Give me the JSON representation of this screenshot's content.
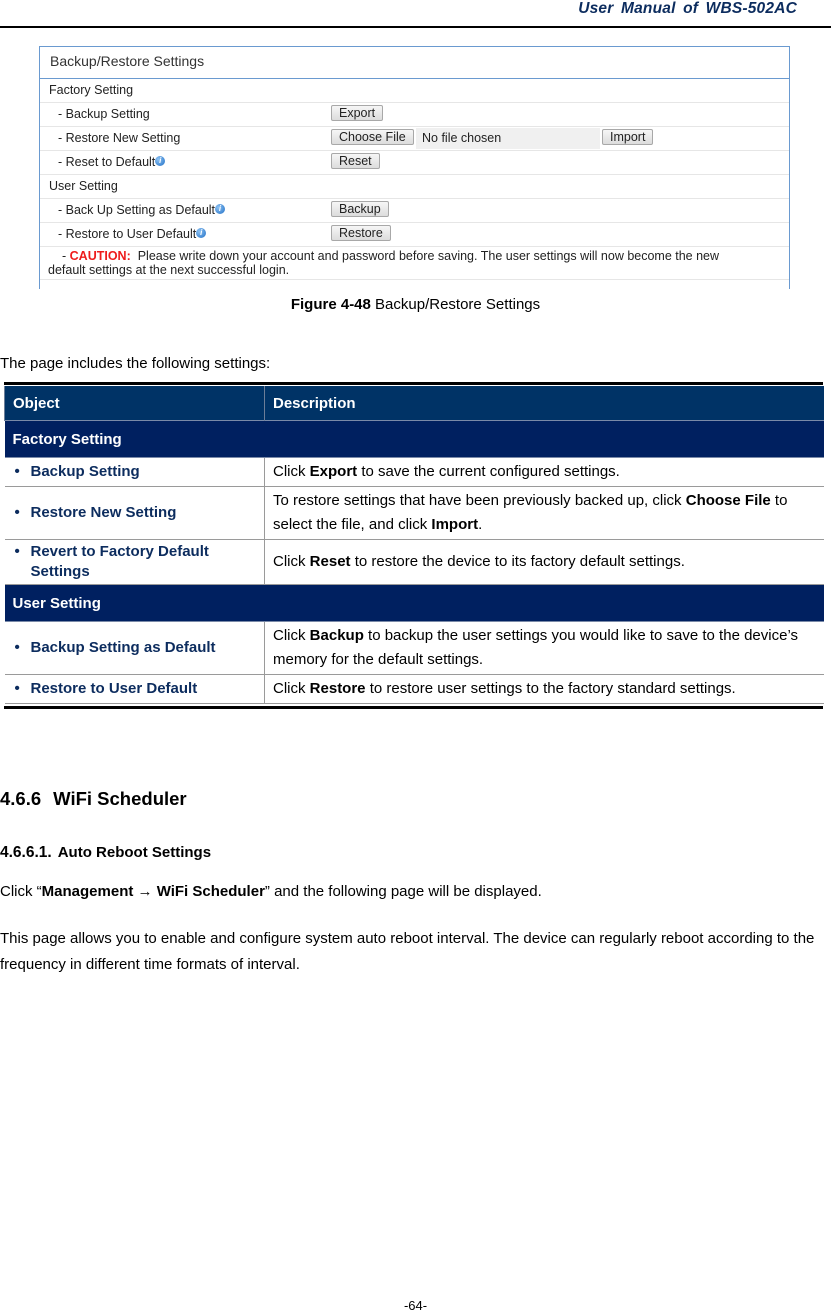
{
  "header": {
    "title": "User  Manual  of  WBS-502AC"
  },
  "figure": {
    "title": "Backup/Restore Settings",
    "sections": [
      {
        "label": "Factory Setting",
        "rows": [
          {
            "label": "- Backup Setting",
            "button": "Export"
          },
          {
            "label": "- Restore New Setting",
            "button": "Choose File",
            "file_status": "No file chosen",
            "button2": "Import"
          },
          {
            "label": "- Reset to Default",
            "button": "Reset",
            "info_icon": true
          }
        ]
      },
      {
        "label": "User Setting",
        "rows": [
          {
            "label": "- Back Up Setting as Default",
            "button": "Backup",
            "info_icon": true
          },
          {
            "label": "- Restore to User Default",
            "button": "Restore",
            "info_icon": true
          }
        ]
      }
    ],
    "caution": {
      "prefix": "- ",
      "word": "CAUTION:",
      "line1": "Please write down your account and password before saving. The user settings will now become the new",
      "line2": "default settings at the next successful login."
    },
    "caption_bold": "Figure 4-48",
    "caption_text": " Backup/Restore Settings"
  },
  "intro": "The page includes the following settings:",
  "table": {
    "headers": [
      "Object",
      "Description"
    ],
    "sections": [
      {
        "title": "Factory Setting",
        "rows": [
          {
            "object": "Backup Setting",
            "desc": [
              [
                "Click "
              ],
              [
                "Export",
                true
              ],
              [
                " to save the current configured settings."
              ]
            ]
          },
          {
            "object": "Restore New Setting",
            "desc": [
              [
                "To restore settings that have been previously backed up, click "
              ],
              [
                "Choose File",
                true
              ],
              [
                " to select the file, and click "
              ],
              [
                "Import",
                true
              ],
              [
                "."
              ]
            ]
          },
          {
            "object": "Revert to Factory Default",
            "object_line2": "Settings",
            "desc": [
              [
                "Click "
              ],
              [
                "Reset",
                true
              ],
              [
                " to restore the device to its factory default settings."
              ]
            ]
          }
        ]
      },
      {
        "title": "User Setting",
        "rows": [
          {
            "object": "Backup Setting as Default",
            "desc": [
              [
                "Click "
              ],
              [
                "Backup",
                true
              ],
              [
                " to backup the user settings you would like to save to the device’s memory for the default settings."
              ]
            ]
          },
          {
            "object": "Restore to User Default",
            "desc": [
              [
                "Click "
              ],
              [
                "Restore",
                true
              ],
              [
                " to restore user settings to the factory standard settings."
              ]
            ]
          }
        ]
      }
    ]
  },
  "section": {
    "number": "4.6.6",
    "title": "WiFi Scheduler"
  },
  "subsection": {
    "number": "4.6.6.1.",
    "title": "Auto Reboot Settings"
  },
  "para1": {
    "pre": "Click “",
    "bold": "Management → WiFi Scheduler",
    "post": "” and the following page will be displayed."
  },
  "para2": "This page allows you to enable and configure system auto reboot interval. The device can regularly reboot according to the frequency in different time formats of interval.",
  "footer": {
    "page": "-64-"
  }
}
